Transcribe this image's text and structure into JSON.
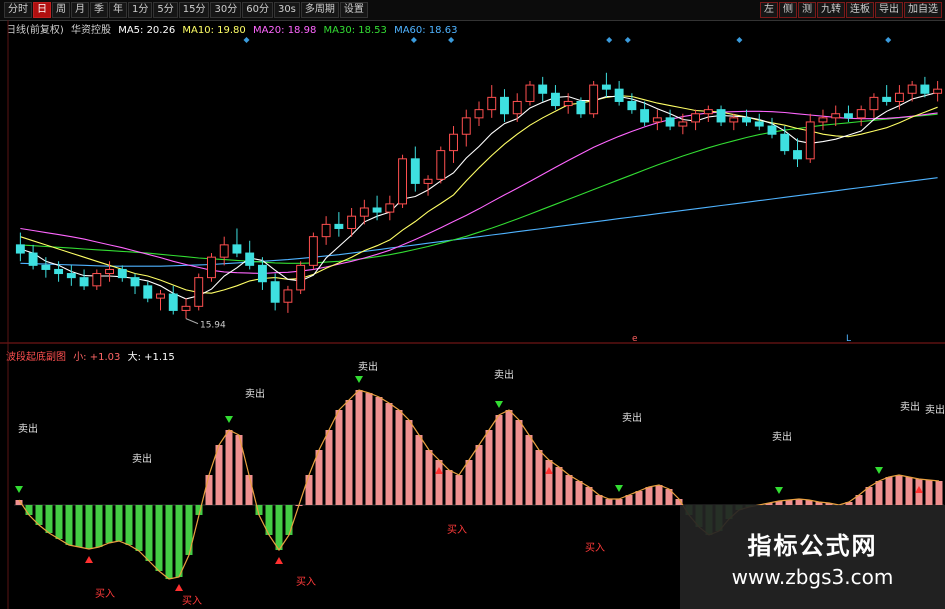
{
  "toolbar": {
    "left_items": [
      "分时",
      "日",
      "周",
      "月",
      "季",
      "年",
      "1分",
      "5分",
      "15分",
      "30分",
      "60分",
      "30s",
      "多周期",
      "设置"
    ],
    "active_index": 1,
    "right_items": [
      "左",
      "侧",
      "测",
      "九转",
      "连板",
      "导出",
      "加自选"
    ]
  },
  "main_legend": {
    "period": "日线(前复权)",
    "name": "华资控股",
    "ma": [
      {
        "label": "MA5: 20.26",
        "color": "#ffffff"
      },
      {
        "label": "MA10: 19.80",
        "color": "#ffff66"
      },
      {
        "label": "MA20: 18.98",
        "color": "#ff66ff"
      },
      {
        "label": "MA30: 18.53",
        "color": "#33dd33"
      },
      {
        "label": "MA60: 18.63",
        "color": "#4fb3ff"
      }
    ]
  },
  "indicator_legend": {
    "name": "波段起底副图",
    "small": "小: +1.03",
    "big": "大: +1.15"
  },
  "colors": {
    "up": "#ff5050",
    "down": "#3ee0e0",
    "hist_pos": "#f09090",
    "hist_neg": "#44cc44",
    "ma5": "#ffffff",
    "ma10": "#ffff66",
    "ma20": "#ff66ff",
    "ma30": "#33dd33",
    "ma60": "#4fb3ff",
    "marker": "#3a9bdc"
  },
  "chart_data": [
    {
      "type": "candlestick",
      "annotation_low": "15.94",
      "annotation_markers": [
        "e",
        "L"
      ],
      "candles": [
        [
          17.6,
          17.9,
          17.2,
          17.4
        ],
        [
          17.4,
          17.6,
          17.0,
          17.1
        ],
        [
          17.1,
          17.3,
          16.8,
          17.0
        ],
        [
          17.0,
          17.2,
          16.7,
          16.9
        ],
        [
          16.9,
          17.1,
          16.6,
          16.8
        ],
        [
          16.8,
          17.0,
          16.5,
          16.6
        ],
        [
          16.6,
          17.0,
          16.5,
          16.9
        ],
        [
          16.9,
          17.2,
          16.7,
          17.0
        ],
        [
          17.0,
          17.1,
          16.7,
          16.8
        ],
        [
          16.8,
          16.9,
          16.4,
          16.6
        ],
        [
          16.6,
          16.7,
          16.2,
          16.3
        ],
        [
          16.3,
          16.5,
          16.0,
          16.4
        ],
        [
          16.4,
          16.6,
          15.9,
          16.0
        ],
        [
          16.0,
          16.3,
          15.8,
          16.1
        ],
        [
          16.1,
          16.9,
          16.0,
          16.8
        ],
        [
          16.8,
          17.4,
          16.7,
          17.3
        ],
        [
          17.3,
          17.8,
          17.1,
          17.6
        ],
        [
          17.6,
          18.0,
          17.3,
          17.4
        ],
        [
          17.4,
          17.7,
          17.0,
          17.1
        ],
        [
          17.1,
          17.3,
          16.5,
          16.7
        ],
        [
          16.7,
          16.9,
          16.0,
          16.2
        ],
        [
          16.2,
          16.6,
          15.94,
          16.5
        ],
        [
          16.5,
          17.2,
          16.4,
          17.1
        ],
        [
          17.1,
          17.9,
          17.0,
          17.8
        ],
        [
          17.8,
          18.3,
          17.6,
          18.1
        ],
        [
          18.1,
          18.4,
          17.8,
          18.0
        ],
        [
          18.0,
          18.5,
          17.8,
          18.3
        ],
        [
          18.3,
          18.7,
          18.1,
          18.5
        ],
        [
          18.5,
          18.8,
          18.2,
          18.4
        ],
        [
          18.4,
          18.8,
          18.2,
          18.6
        ],
        [
          18.6,
          19.8,
          18.5,
          19.7
        ],
        [
          19.7,
          20.0,
          18.9,
          19.1
        ],
        [
          19.1,
          19.3,
          18.8,
          19.2
        ],
        [
          19.2,
          20.0,
          19.1,
          19.9
        ],
        [
          19.9,
          20.5,
          19.6,
          20.3
        ],
        [
          20.3,
          20.9,
          20.0,
          20.7
        ],
        [
          20.7,
          21.1,
          20.5,
          20.9
        ],
        [
          20.9,
          21.5,
          20.7,
          21.2
        ],
        [
          21.2,
          21.4,
          20.6,
          20.8
        ],
        [
          20.8,
          21.3,
          20.6,
          21.1
        ],
        [
          21.1,
          21.6,
          21.0,
          21.5
        ],
        [
          21.5,
          21.7,
          21.1,
          21.3
        ],
        [
          21.3,
          21.5,
          20.9,
          21.0
        ],
        [
          21.0,
          21.3,
          20.8,
          21.1
        ],
        [
          21.1,
          21.2,
          20.7,
          20.8
        ],
        [
          20.8,
          21.6,
          20.7,
          21.5
        ],
        [
          21.5,
          21.8,
          21.2,
          21.4
        ],
        [
          21.4,
          21.6,
          21.0,
          21.1
        ],
        [
          21.1,
          21.3,
          20.8,
          20.9
        ],
        [
          20.9,
          21.1,
          20.5,
          20.6
        ],
        [
          20.6,
          20.9,
          20.4,
          20.7
        ],
        [
          20.7,
          20.9,
          20.4,
          20.5
        ],
        [
          20.5,
          20.8,
          20.3,
          20.6
        ],
        [
          20.6,
          20.9,
          20.4,
          20.8
        ],
        [
          20.8,
          21.0,
          20.6,
          20.9
        ],
        [
          20.9,
          21.0,
          20.5,
          20.6
        ],
        [
          20.6,
          20.8,
          20.4,
          20.7
        ],
        [
          20.7,
          20.9,
          20.5,
          20.6
        ],
        [
          20.6,
          20.8,
          20.4,
          20.5
        ],
        [
          20.5,
          20.7,
          20.2,
          20.3
        ],
        [
          20.3,
          20.5,
          19.8,
          19.9
        ],
        [
          19.9,
          20.2,
          19.5,
          19.7
        ],
        [
          19.7,
          20.8,
          19.6,
          20.6
        ],
        [
          20.6,
          20.9,
          20.4,
          20.7
        ],
        [
          20.7,
          21.0,
          20.5,
          20.8
        ],
        [
          20.8,
          21.0,
          20.6,
          20.7
        ],
        [
          20.7,
          21.0,
          20.5,
          20.9
        ],
        [
          20.9,
          21.3,
          20.7,
          21.2
        ],
        [
          21.2,
          21.5,
          21.0,
          21.1
        ],
        [
          21.1,
          21.5,
          20.9,
          21.3
        ],
        [
          21.3,
          21.6,
          21.1,
          21.5
        ],
        [
          21.5,
          21.7,
          21.2,
          21.3
        ],
        [
          21.3,
          21.6,
          21.1,
          21.4
        ]
      ],
      "ma5": [
        17.5,
        17.4,
        17.2,
        17.1,
        16.95,
        16.85,
        16.84,
        16.84,
        16.82,
        16.78,
        16.72,
        16.6,
        16.42,
        16.28,
        16.36,
        16.52,
        16.84,
        17.04,
        17.28,
        17.22,
        16.98,
        16.76,
        16.72,
        16.86,
        17.28,
        17.56,
        17.84,
        18.16,
        18.3,
        18.4,
        18.72,
        18.78,
        18.94,
        19.16,
        19.36,
        19.72,
        20.0,
        20.32,
        20.56,
        20.68,
        20.94,
        21.08,
        21.2,
        21.22,
        21.12,
        21.12,
        21.22,
        21.22,
        21.16,
        21.06,
        20.92,
        20.8,
        20.66,
        20.62,
        20.72,
        20.76,
        20.74,
        20.72,
        20.66,
        20.56,
        20.38,
        20.14,
        20.08,
        20.12,
        20.18,
        20.28,
        20.38,
        20.66,
        20.86,
        21.0,
        21.16,
        21.24,
        21.32
      ],
      "ma10": [
        17.8,
        17.7,
        17.6,
        17.5,
        17.4,
        17.3,
        17.2,
        17.1,
        17.0,
        16.9,
        16.84,
        16.74,
        16.62,
        16.5,
        16.44,
        16.42,
        16.5,
        16.6,
        16.72,
        16.78,
        16.8,
        16.76,
        16.78,
        16.88,
        17.03,
        17.16,
        17.3,
        17.46,
        17.58,
        17.72,
        17.96,
        18.17,
        18.41,
        18.61,
        18.82,
        19.16,
        19.48,
        19.78,
        20.06,
        20.3,
        20.52,
        20.7,
        20.86,
        21.02,
        21.06,
        21.12,
        21.2,
        21.24,
        21.22,
        21.14,
        21.06,
        21.0,
        20.94,
        20.88,
        20.86,
        20.84,
        20.78,
        20.72,
        20.64,
        20.58,
        20.52,
        20.44,
        20.38,
        20.3,
        20.26,
        20.24,
        20.3,
        20.38,
        20.46,
        20.58,
        20.72,
        20.84,
        20.96
      ],
      "ma20": [
        18.0,
        17.95,
        17.9,
        17.85,
        17.8,
        17.74,
        17.67,
        17.6,
        17.53,
        17.45,
        17.37,
        17.29,
        17.2,
        17.12,
        17.05,
        16.98,
        16.94,
        16.92,
        16.91,
        16.9,
        16.92,
        16.93,
        16.96,
        17.0,
        17.06,
        17.13,
        17.2,
        17.28,
        17.37,
        17.47,
        17.6,
        17.73,
        17.87,
        18.02,
        18.17,
        18.32,
        18.48,
        18.65,
        18.82,
        18.98,
        19.15,
        19.32,
        19.49,
        19.66,
        19.82,
        19.98,
        20.12,
        20.25,
        20.37,
        20.48,
        20.58,
        20.66,
        20.73,
        20.78,
        20.82,
        20.84,
        20.85,
        20.86,
        20.86,
        20.85,
        20.83,
        20.8,
        20.77,
        20.74,
        20.71,
        20.69,
        20.68,
        20.68,
        20.69,
        20.71,
        20.74,
        20.78,
        20.82
      ],
      "ma30": [
        17.6,
        17.58,
        17.56,
        17.54,
        17.52,
        17.5,
        17.48,
        17.46,
        17.44,
        17.42,
        17.4,
        17.37,
        17.34,
        17.31,
        17.28,
        17.26,
        17.24,
        17.22,
        17.2,
        17.18,
        17.16,
        17.15,
        17.15,
        17.16,
        17.18,
        17.2,
        17.23,
        17.27,
        17.31,
        17.36,
        17.42,
        17.49,
        17.56,
        17.64,
        17.72,
        17.81,
        17.91,
        18.01,
        18.12,
        18.23,
        18.35,
        18.47,
        18.59,
        18.71,
        18.83,
        18.95,
        19.07,
        19.19,
        19.31,
        19.43,
        19.55,
        19.66,
        19.77,
        19.87,
        19.97,
        20.06,
        20.14,
        20.22,
        20.29,
        20.35,
        20.4,
        20.44,
        20.48,
        20.52,
        20.55,
        20.58,
        20.61,
        20.64,
        20.67,
        20.7,
        20.73,
        20.76,
        20.79
      ],
      "ma60": [
        17.15,
        17.14,
        17.13,
        17.12,
        17.11,
        17.1,
        17.09,
        17.08,
        17.08,
        17.08,
        17.08,
        17.08,
        17.09,
        17.1,
        17.11,
        17.12,
        17.14,
        17.16,
        17.18,
        17.2,
        17.22,
        17.24,
        17.27,
        17.3,
        17.33,
        17.36,
        17.4,
        17.44,
        17.48,
        17.52,
        17.56,
        17.6,
        17.64,
        17.68,
        17.72,
        17.76,
        17.8,
        17.84,
        17.88,
        17.92,
        17.96,
        18.0,
        18.04,
        18.08,
        18.12,
        18.16,
        18.2,
        18.24,
        18.28,
        18.32,
        18.36,
        18.4,
        18.44,
        18.48,
        18.52,
        18.56,
        18.6,
        18.64,
        18.68,
        18.72,
        18.76,
        18.8,
        18.84,
        18.88,
        18.92,
        18.96,
        19.0,
        19.04,
        19.08,
        19.12,
        19.16,
        19.2,
        19.24
      ],
      "ylim": [
        15.4,
        22.6
      ]
    },
    {
      "type": "bar",
      "values": [
        0.05,
        -0.1,
        -0.2,
        -0.28,
        -0.34,
        -0.4,
        -0.42,
        -0.44,
        -0.42,
        -0.38,
        -0.36,
        -0.4,
        -0.46,
        -0.56,
        -0.66,
        -0.74,
        -0.72,
        -0.5,
        -0.1,
        0.3,
        0.6,
        0.75,
        0.7,
        0.3,
        -0.1,
        -0.3,
        -0.45,
        -0.3,
        0.0,
        0.3,
        0.55,
        0.75,
        0.95,
        1.05,
        1.15,
        1.12,
        1.08,
        1.02,
        0.95,
        0.85,
        0.7,
        0.55,
        0.45,
        0.35,
        0.3,
        0.45,
        0.6,
        0.75,
        0.9,
        0.95,
        0.85,
        0.7,
        0.55,
        0.45,
        0.38,
        0.3,
        0.24,
        0.18,
        0.1,
        0.06,
        0.06,
        0.1,
        0.14,
        0.18,
        0.2,
        0.16,
        0.06,
        -0.1,
        -0.22,
        -0.3,
        -0.26,
        -0.14,
        -0.05,
        -0.02,
        0.0,
        0.02,
        0.04,
        0.05,
        0.06,
        0.05,
        0.03,
        0.02,
        0.0,
        0.03,
        0.1,
        0.18,
        0.24,
        0.28,
        0.3,
        0.28,
        0.26,
        0.25,
        0.24
      ],
      "ylim": [
        -1.0,
        1.45
      ],
      "labels_sell": [
        "卖出",
        "卖出",
        "卖出",
        "卖出",
        "卖出",
        "卖出",
        "卖出",
        "卖出",
        "卖出"
      ],
      "labels_buy": [
        "买入",
        "买入",
        "买入",
        "买入",
        "买入"
      ]
    }
  ],
  "watermark": {
    "title": "指标公式网",
    "url": "www.zbgs3.com"
  }
}
